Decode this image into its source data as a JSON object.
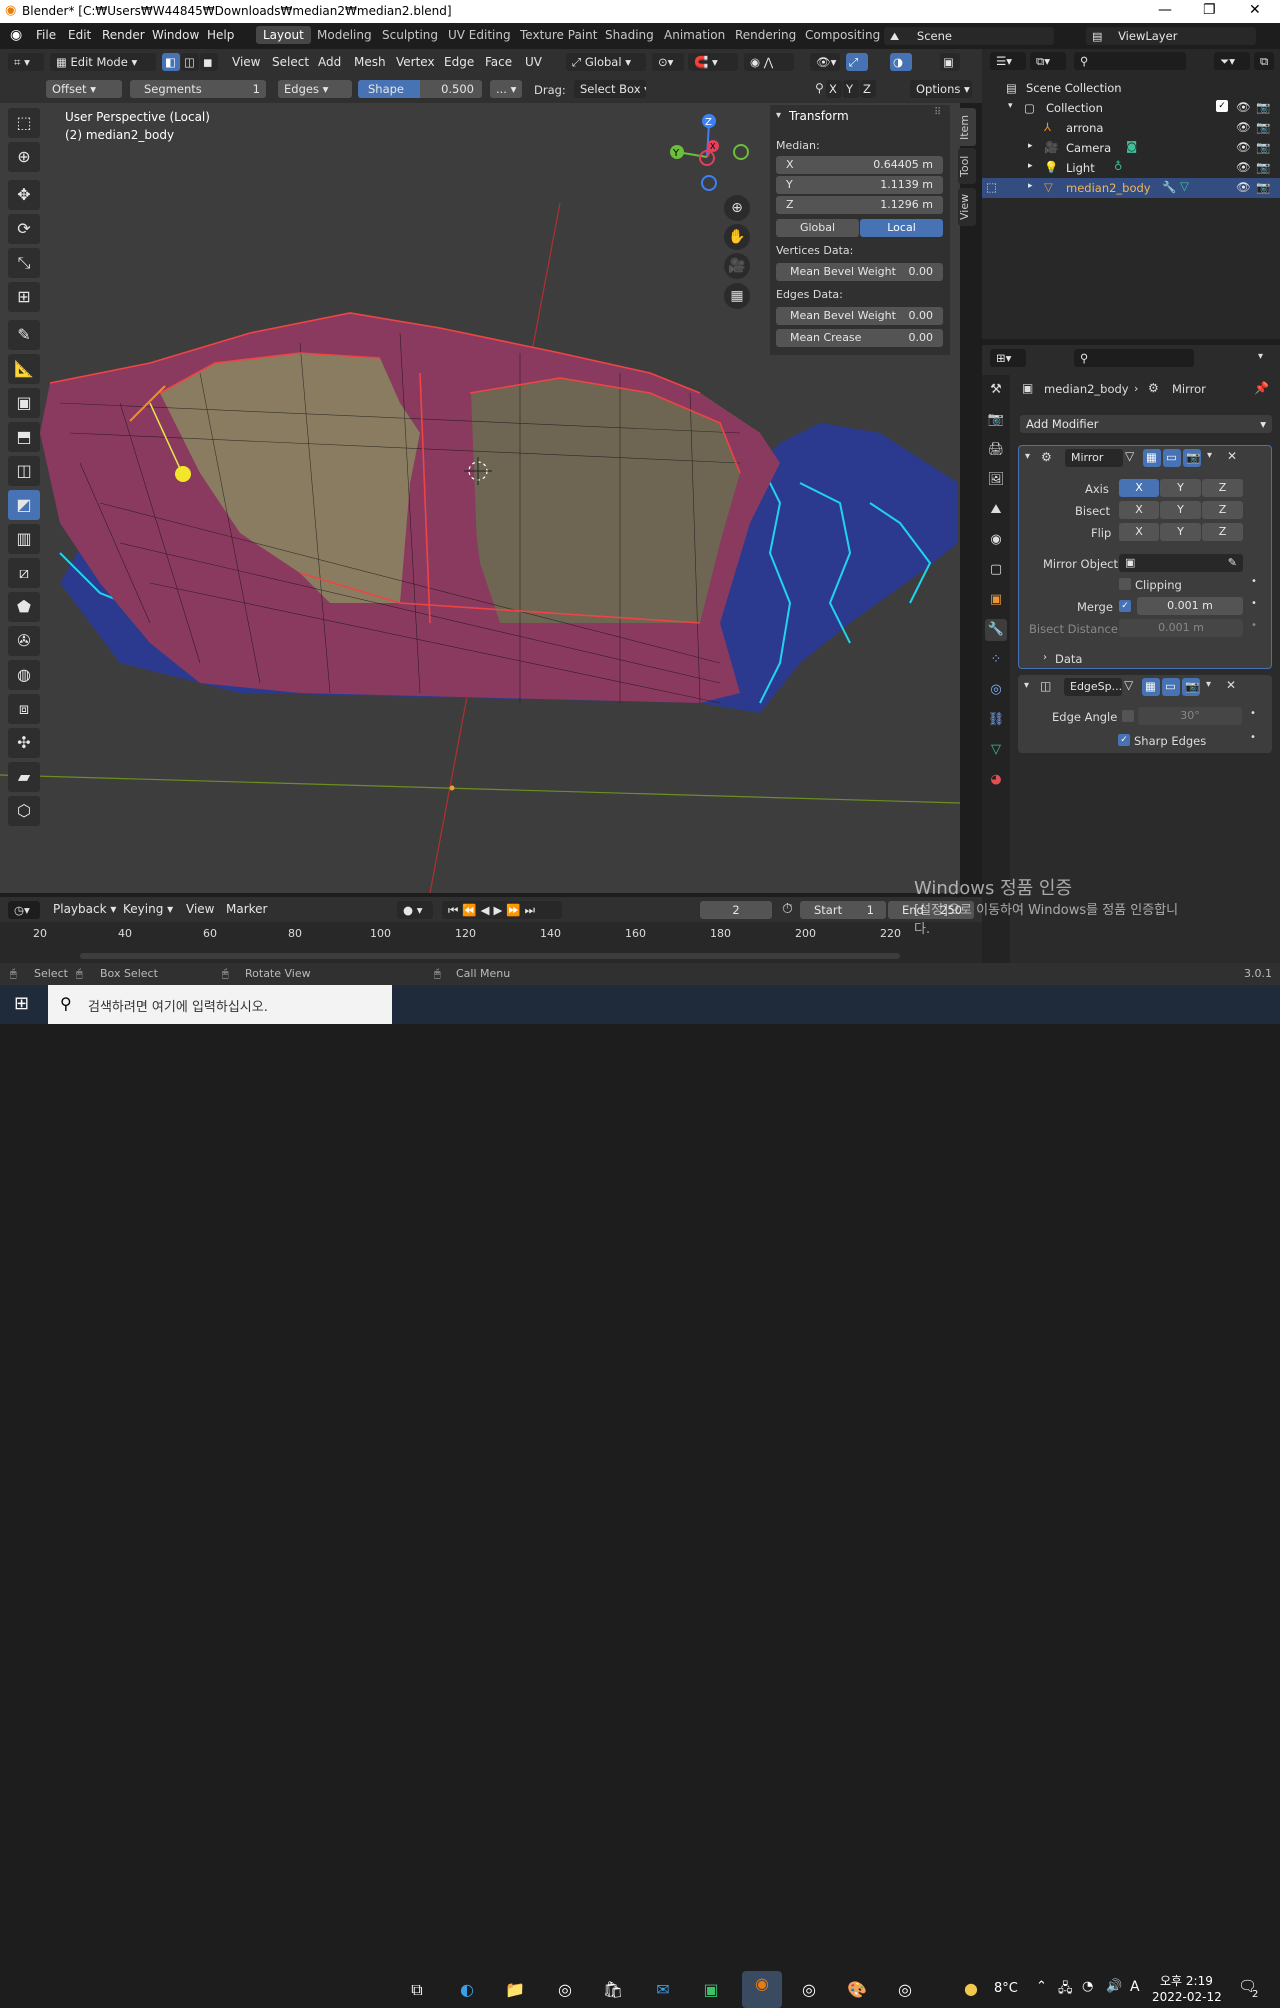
{
  "window": {
    "title": "Blender* [C:₩Users₩W44845₩Downloads₩median2₩median2.blend]",
    "min": "—",
    "max": "❐",
    "close": "✕"
  },
  "menu": [
    "File",
    "Edit",
    "Render",
    "Window",
    "Help"
  ],
  "workspaces": [
    "Layout",
    "Modeling",
    "Sculpting",
    "UV Editing",
    "Texture Paint",
    "Shading",
    "Animation",
    "Rendering",
    "Compositing"
  ],
  "scene": {
    "label": "Scene",
    "viewlayer": "ViewLayer"
  },
  "header": {
    "mode": "Edit Mode",
    "menus": [
      "View",
      "Select",
      "Add",
      "Mesh",
      "Vertex",
      "Edge",
      "Face",
      "UV"
    ],
    "orientation": "Global",
    "axes": [
      "X",
      "Y",
      "Z"
    ],
    "options": "Options"
  },
  "bevel": {
    "offset": "Offset",
    "segments_label": "Segments",
    "segments_value": "1",
    "affect": "Edges",
    "shape_label": "Shape",
    "shape_value": "0.500",
    "more": "...",
    "drag_label": "Drag:",
    "drag_value": "Select Box"
  },
  "viewport": {
    "line1": "User Perspective (Local)",
    "line2": "(2) median2_body",
    "gizmo": [
      "Z",
      "Y",
      "X"
    ]
  },
  "npanel": {
    "title": "Transform",
    "median": "Median:",
    "x_label": "X",
    "x": "0.64405 m",
    "y_label": "Y",
    "y": "1.1139 m",
    "z_label": "Z",
    "z": "1.1296 m",
    "global": "Global",
    "local": "Local",
    "verts_data": "Vertices Data:",
    "mean_bevel_v": "Mean Bevel Weight",
    "mean_bevel_v_val": "0.00",
    "edges_data": "Edges Data:",
    "mean_bevel_e": "Mean Bevel Weight",
    "mean_bevel_e_val": "0.00",
    "mean_crease": "Mean Crease",
    "mean_crease_val": "0.00",
    "tabs": [
      "Item",
      "Tool",
      "View"
    ]
  },
  "outliner": {
    "root": "Scene Collection",
    "collection": "Collection",
    "items": [
      "arrona",
      "Camera",
      "Light",
      "median2_body"
    ]
  },
  "properties": {
    "breadcrumb_obj": "median2_body",
    "breadcrumb_mod": "Mirror",
    "add_modifier": "Add Modifier",
    "mirror": {
      "name": "Mirror",
      "axis": "Axis",
      "bisect": "Bisect",
      "flip": "Flip",
      "x": "X",
      "y": "Y",
      "z": "Z",
      "mirror_object": "Mirror Object",
      "clipping": "Clipping",
      "merge": "Merge",
      "merge_val": "0.001 m",
      "bisect_distance": "Bisect Distance",
      "bisect_distance_val": "0.001 m",
      "data": "Data"
    },
    "edgesplit": {
      "name": "EdgeSp...",
      "edge_angle": "Edge Angle",
      "edge_angle_val": "30°",
      "sharp_edges": "Sharp Edges"
    }
  },
  "timeline": {
    "menus": [
      "Playback",
      "Keying",
      "View",
      "Marker"
    ],
    "frame": "2",
    "start_label": "Start",
    "start": "1",
    "end_label": "End",
    "end": "250",
    "ticks": [
      "20",
      "40",
      "60",
      "80",
      "100",
      "120",
      "140",
      "160",
      "180",
      "200",
      "220"
    ]
  },
  "status": {
    "select": "Select",
    "box_select": "Box Select",
    "rotate": "Rotate View",
    "call_menu": "Call Menu",
    "version": "3.0.1"
  },
  "watermark": {
    "line1": "Windows 정품 인증",
    "line2": "[설정]으로 이동하여 Windows를 정품 인증합니",
    "line3": "다."
  },
  "taskbar": {
    "search": "검색하려면 여기에 입력하십시오.",
    "temp": "8°C",
    "ime": "A",
    "time": "오후 2:19",
    "date": "2022-02-12",
    "notif": "2"
  }
}
